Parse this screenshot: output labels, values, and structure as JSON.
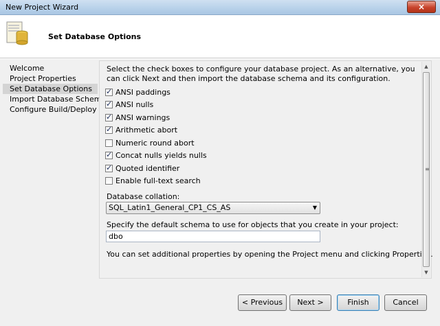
{
  "window": {
    "title": "New Project Wizard",
    "close_glyph": "×"
  },
  "header": {
    "icon": "database-icon",
    "heading": "Set Database Options"
  },
  "nav": {
    "items": [
      {
        "label": "Welcome",
        "selected": false
      },
      {
        "label": "Project Properties",
        "selected": false
      },
      {
        "label": "Set Database Options",
        "selected": true
      },
      {
        "label": "Import Database Schema",
        "selected": false
      },
      {
        "label": "Configure Build/Deploy",
        "selected": false
      }
    ]
  },
  "panel": {
    "intro": "Select the check boxes to configure your database project. As an alternative, you can click Next and then import the database schema and its configuration.",
    "options": [
      {
        "label": "ANSI paddings",
        "checked": true
      },
      {
        "label": "ANSI nulls",
        "checked": true
      },
      {
        "label": "ANSI warnings",
        "checked": true
      },
      {
        "label": "Arithmetic abort",
        "checked": true
      },
      {
        "label": "Numeric round abort",
        "checked": false
      },
      {
        "label": "Concat nulls yields nulls",
        "checked": true
      },
      {
        "label": "Quoted identifier",
        "checked": true
      },
      {
        "label": "Enable full-text search",
        "checked": false
      }
    ],
    "collation_label": "Database collation:",
    "collation_value": "SQL_Latin1_General_CP1_CS_AS",
    "schema_label": "Specify the default schema to use for objects that you create in your project:",
    "schema_value": "dbo",
    "note": "You can set additional properties by opening the Project menu and clicking Properties."
  },
  "buttons": {
    "previous": "< Previous",
    "next": "Next >",
    "finish": "Finish",
    "cancel": "Cancel"
  }
}
